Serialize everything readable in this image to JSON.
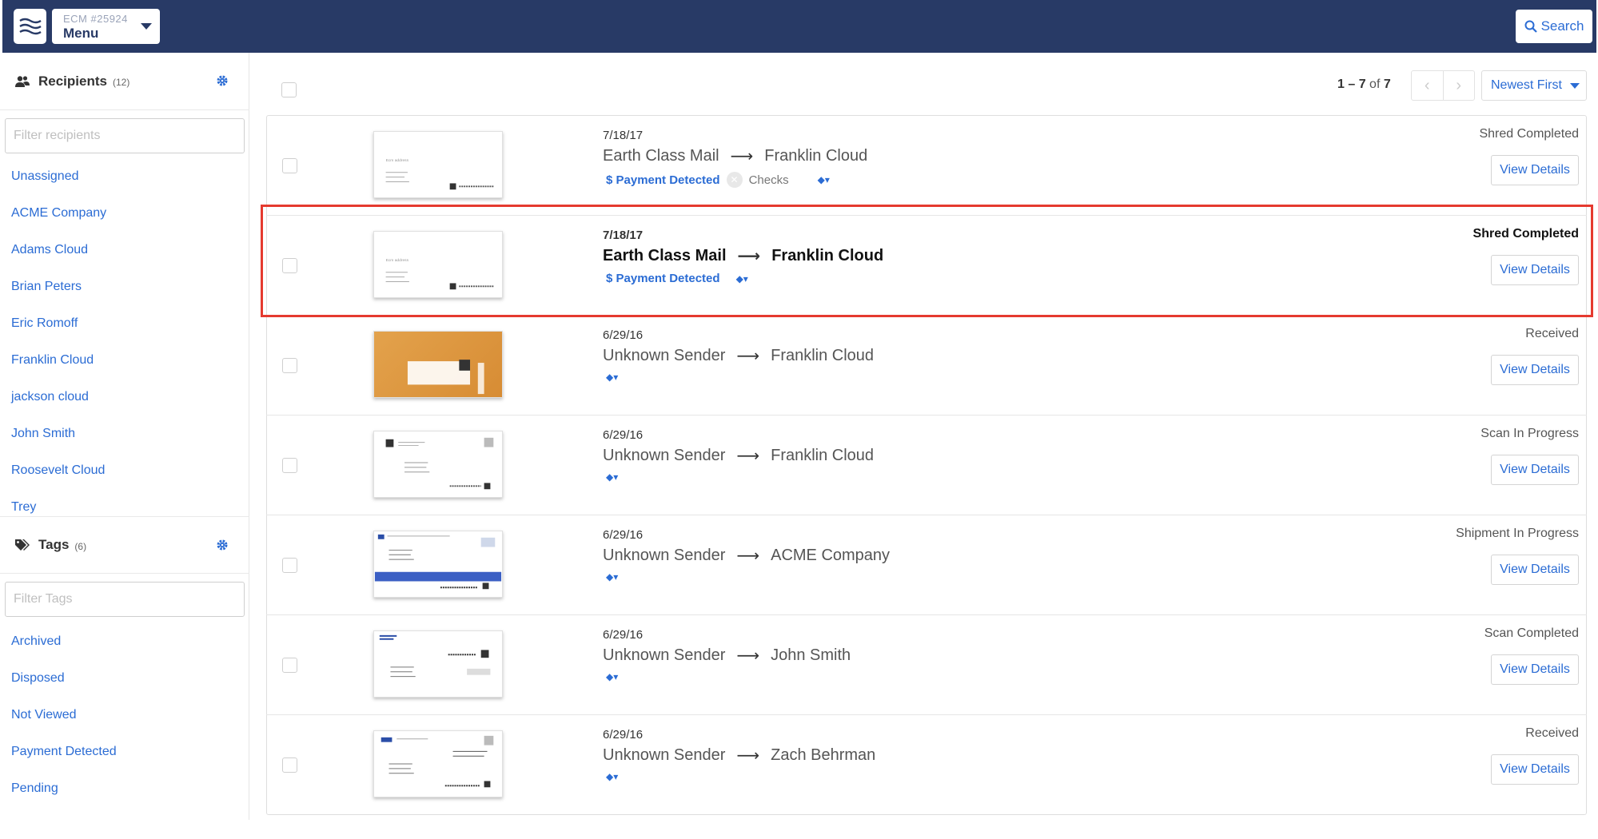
{
  "header": {
    "account_id": "ECM #25924",
    "menu_label": "Menu",
    "search_label": "Search"
  },
  "sidebar": {
    "recipients": {
      "title": "Recipients",
      "count": "(12)",
      "filter_placeholder": "Filter recipients",
      "items": [
        "Unassigned",
        "ACME Company",
        "Adams Cloud",
        "Brian Peters",
        "Eric Romoff",
        "Franklin Cloud",
        "jackson cloud",
        "John Smith",
        "Roosevelt Cloud",
        "Trey"
      ]
    },
    "tags": {
      "title": "Tags",
      "count": "(6)",
      "filter_placeholder": "Filter Tags",
      "items": [
        "Archived",
        "Disposed",
        "Not Viewed",
        "Payment Detected",
        "Pending"
      ]
    }
  },
  "toolbar": {
    "range": "1 – 7",
    "of_label": "of",
    "total": "7",
    "sort_label": "Newest First"
  },
  "mail": [
    {
      "date": "7/18/17",
      "sender": "Earth Class Mail",
      "recipient": "Franklin Cloud",
      "payment": "$ Payment Detected",
      "checks": "Checks",
      "status": "Shred Completed",
      "button": "View Details"
    },
    {
      "date": "7/18/17",
      "sender": "Earth Class Mail",
      "recipient": "Franklin Cloud",
      "payment": "$ Payment Detected",
      "status": "Shred Completed",
      "button": "View Details"
    },
    {
      "date": "6/29/16",
      "sender": "Unknown Sender",
      "recipient": "Franklin Cloud",
      "status": "Received",
      "button": "View Details"
    },
    {
      "date": "6/29/16",
      "sender": "Unknown Sender",
      "recipient": "Franklin Cloud",
      "status": "Scan In Progress",
      "button": "View Details"
    },
    {
      "date": "6/29/16",
      "sender": "Unknown Sender",
      "recipient": "ACME Company",
      "status": "Shipment In Progress",
      "button": "View Details"
    },
    {
      "date": "6/29/16",
      "sender": "Unknown Sender",
      "recipient": "John Smith",
      "status": "Scan Completed",
      "button": "View Details"
    },
    {
      "date": "6/29/16",
      "sender": "Unknown Sender",
      "recipient": "Zach Behrman",
      "status": "Received",
      "button": "View Details"
    }
  ],
  "colors": {
    "header_bg": "#283a66",
    "link": "#2b6cd4",
    "highlight": "#e53a2f"
  }
}
